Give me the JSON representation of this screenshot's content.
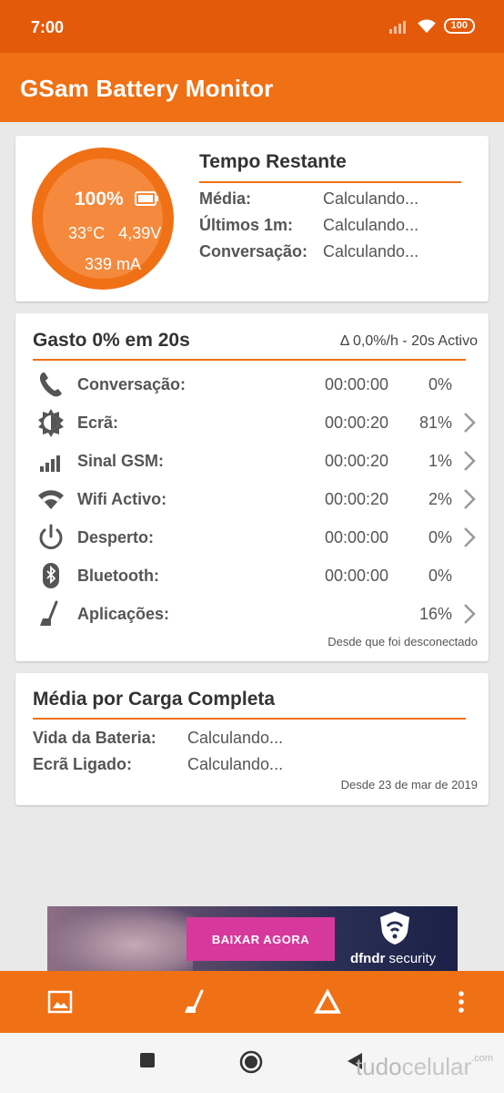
{
  "status": {
    "time": "7:00",
    "battery_badge": "100"
  },
  "app": {
    "title": "GSam Battery Monitor"
  },
  "gauge": {
    "percent": "100%",
    "temperature": "33°C",
    "voltage": "4,39V",
    "current": "339 mA"
  },
  "remaining": {
    "title": "Tempo Restante",
    "rows": [
      {
        "label": "Média:",
        "value": "Calculando..."
      },
      {
        "label": "Últimos 1m:",
        "value": "Calculando..."
      },
      {
        "label": "Conversação:",
        "value": "Calculando..."
      }
    ]
  },
  "usage": {
    "title": "Gasto 0% em 20s",
    "rate": "Δ 0,0%/h - 20s Activo",
    "rows": [
      {
        "icon": "phone-icon",
        "label": "Conversação:",
        "time": "00:00:00",
        "percent": "0%",
        "chevron": false
      },
      {
        "icon": "brightness-icon",
        "label": "Ecrã:",
        "time": "00:00:20",
        "percent": "81%",
        "chevron": true
      },
      {
        "icon": "signal-icon",
        "label": "Sinal GSM:",
        "time": "00:00:20",
        "percent": "1%",
        "chevron": true
      },
      {
        "icon": "wifi-icon",
        "label": "Wifi Activo:",
        "time": "00:00:20",
        "percent": "2%",
        "chevron": true
      },
      {
        "icon": "power-icon",
        "label": "Desperto:",
        "time": "00:00:00",
        "percent": "0%",
        "chevron": true
      },
      {
        "icon": "bluetooth-icon",
        "label": "Bluetooth:",
        "time": "00:00:00",
        "percent": "0%",
        "chevron": false
      },
      {
        "icon": "apps-icon",
        "label": "Aplicações:",
        "time": "",
        "percent": "16%",
        "chevron": true
      }
    ],
    "footer": "Desde que foi desconectado"
  },
  "full_charge": {
    "title": "Média por Carga Completa",
    "rows": [
      {
        "label": "Vida da Bateria:",
        "value": "Calculando..."
      },
      {
        "label": "Ecrã Ligado:",
        "value": "Calculando..."
      }
    ],
    "footer": "Desde 23 de mar de 2019"
  },
  "ad": {
    "button": "BAIXAR AGORA",
    "brand_bold": "dfndr",
    "brand_rest": " security"
  },
  "bottom_bar": {
    "icons": [
      "image-icon",
      "apps-icon",
      "delta-icon",
      "more-vert-icon"
    ]
  },
  "nav": {
    "icons": [
      "recents-icon",
      "home-icon",
      "back-icon"
    ],
    "watermark_a": "tudo",
    "watermark_b": "celular",
    "watermark_c": ".com"
  },
  "colors": {
    "primary": "#f07015",
    "status_bar": "#e35a0a",
    "gauge_inner": "#f5893d",
    "ad_button": "#d6389b"
  }
}
